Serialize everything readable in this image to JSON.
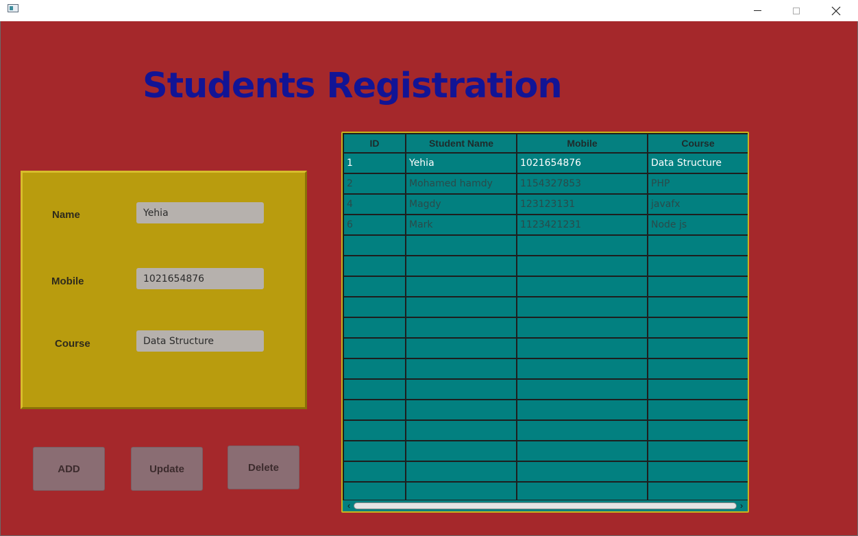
{
  "window": {
    "icon": "app-window-icon",
    "controls": {
      "minimize": "minimize-icon",
      "maximize": "maximize-icon",
      "close": "close-icon"
    }
  },
  "title": "Students Registration",
  "form": {
    "name_label": "Name",
    "name_value": "Yehia",
    "mobile_label": "Mobile",
    "mobile_value": "1021654876",
    "course_label": "Course",
    "course_value": "Data Structure"
  },
  "buttons": {
    "add": "ADD",
    "update": "Update",
    "delete": "Delete"
  },
  "table": {
    "columns": [
      "ID",
      "Student Name",
      "Mobile",
      "Course"
    ],
    "rows": [
      [
        "1",
        "Yehia",
        "1021654876",
        "Data Structure"
      ],
      [
        "2",
        "Mohamed hamdy",
        "1154327853",
        "PHP"
      ],
      [
        "4",
        "Magdy",
        "123123131",
        "javafx"
      ],
      [
        "6",
        "Mark",
        "1123421231",
        "Node js"
      ]
    ],
    "selected_row": 0
  },
  "scrollbar": {
    "left_arrow": "‹",
    "right_arrow": "›"
  },
  "colors": {
    "background": "#a5282b",
    "title": "#121495",
    "panel": "#b99c0e",
    "table_cell": "#028080",
    "button": "#8a6d73"
  }
}
